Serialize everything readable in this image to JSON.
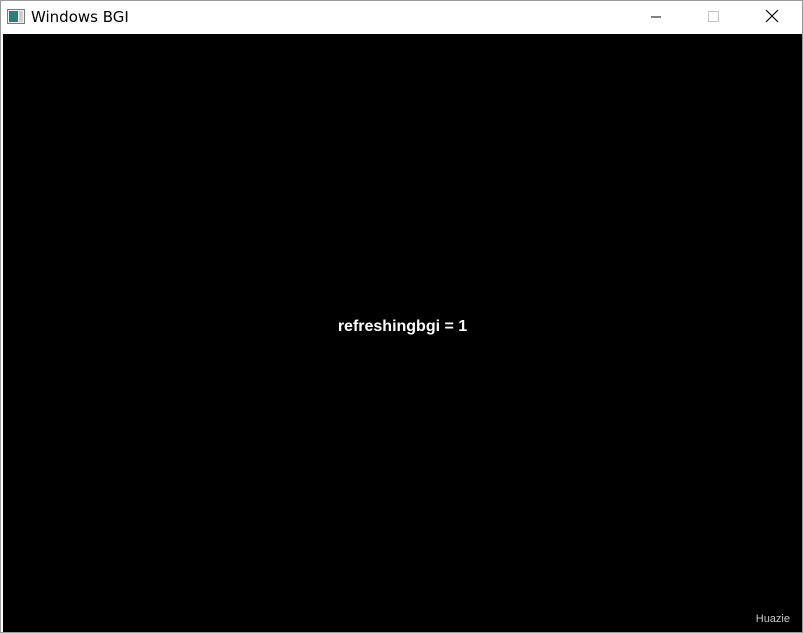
{
  "window": {
    "title": "Windows BGI",
    "app_icon": "window-app-icon",
    "controls": {
      "minimize_icon": "minimize-icon",
      "maximize_icon": "maximize-icon",
      "close_icon": "close-icon"
    }
  },
  "canvas": {
    "background_color": "#000000",
    "text_color": "#ffffff",
    "message": "refreshingbgi = 1",
    "watermark": "Huazie"
  }
}
